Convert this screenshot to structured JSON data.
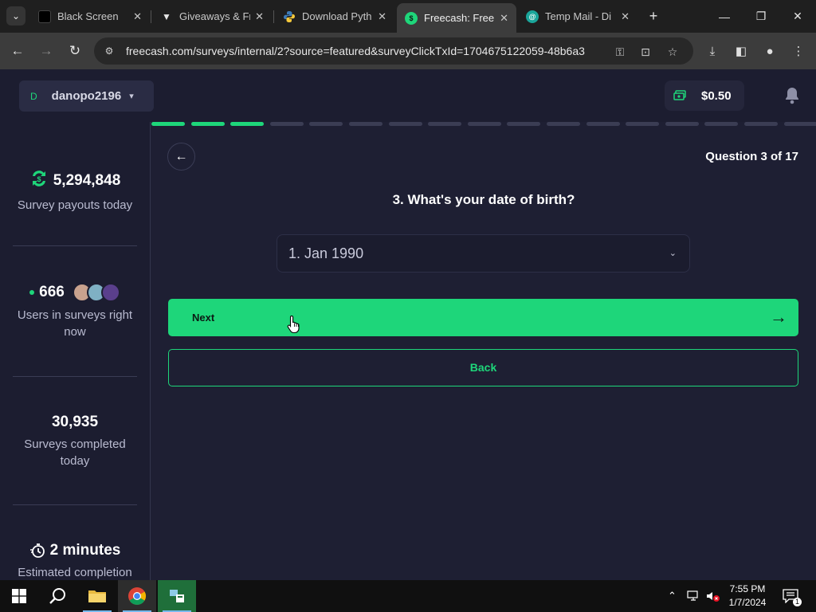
{
  "browser": {
    "tabs": [
      {
        "title": "Black Screen",
        "favicon_color": "#000000"
      },
      {
        "title": "Giveaways & Fr",
        "favicon_color": "#e6e6e6"
      },
      {
        "title": "Download Pyth",
        "favicon_color": "#3d7ab8"
      },
      {
        "title": "Freecash: Free C",
        "favicon_color": "#1ed67a"
      },
      {
        "title": "Temp Mail - Di",
        "favicon_color": "#1aa59a"
      }
    ],
    "active_tab": 3,
    "url": "freecash.com/surveys/internal/2?source=featured&surveyClickTxId=1704675122059-48b6a3"
  },
  "header": {
    "avatar_letter": "D",
    "username": "danopo2196",
    "balance": "$0.50"
  },
  "progress": {
    "current": 3,
    "total_segments": 17
  },
  "sidebar": {
    "payouts_value": "5,294,848",
    "payouts_label": "Survey payouts today",
    "users_value": "666",
    "users_label": "Users in surveys right now",
    "completed_value": "30,935",
    "completed_label": "Surveys completed today",
    "estimate_value": "2 minutes",
    "estimate_label": "Estimated completion"
  },
  "survey": {
    "question_counter": "Question 3 of 17",
    "question": "3. What's your date of birth?",
    "selected_value": "1. Jan 1990",
    "next_label": "Next",
    "back_label": "Back"
  },
  "taskbar": {
    "time": "7:55 PM",
    "date": "1/7/2024",
    "notification_count": "1"
  },
  "colors": {
    "accent": "#1ed67a",
    "background": "#1e1f33"
  }
}
